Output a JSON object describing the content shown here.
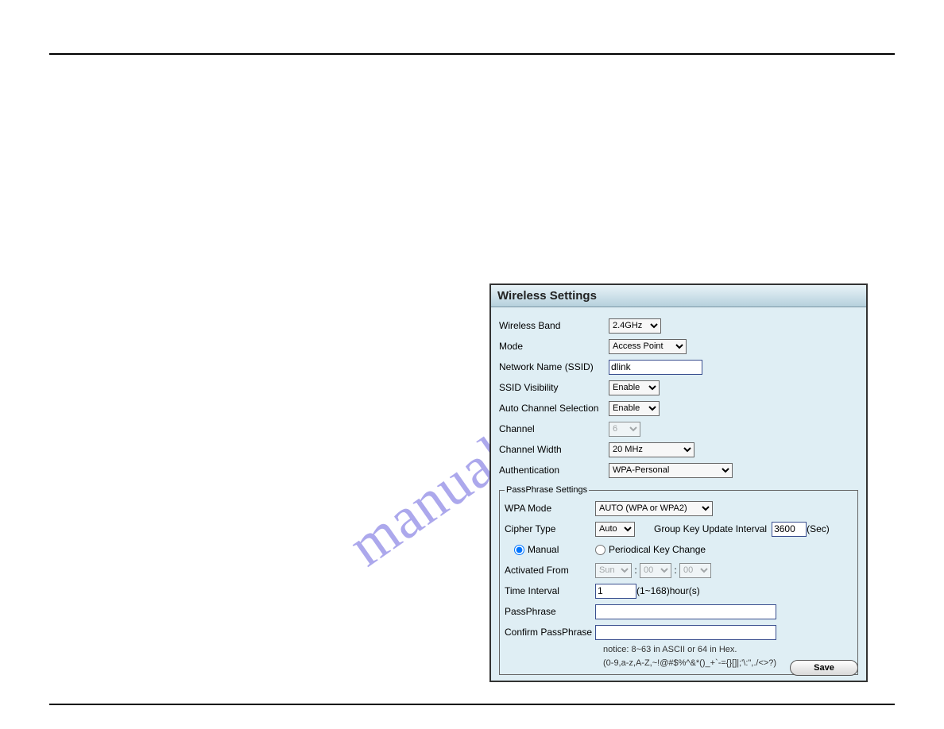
{
  "watermark": "manualshive.com",
  "panel": {
    "title": "Wireless Settings",
    "wireless_band": {
      "label": "Wireless Band",
      "value": "2.4GHz"
    },
    "mode": {
      "label": "Mode",
      "value": "Access Point"
    },
    "ssid": {
      "label": "Network Name (SSID)",
      "value": "dlink"
    },
    "ssid_visibility": {
      "label": "SSID Visibility",
      "value": "Enable"
    },
    "auto_channel": {
      "label": "Auto Channel Selection",
      "value": "Enable"
    },
    "channel": {
      "label": "Channel",
      "value": "6"
    },
    "channel_width": {
      "label": "Channel Width",
      "value": "20 MHz"
    },
    "authentication": {
      "label": "Authentication",
      "value": "WPA-Personal"
    },
    "passphrase": {
      "legend": "PassPhrase Settings",
      "wpa_mode": {
        "label": "WPA Mode",
        "value": "AUTO (WPA or WPA2)"
      },
      "cipher_type": {
        "label": "Cipher Type",
        "value": "Auto"
      },
      "group_key": {
        "label": "Group Key Update Interval",
        "value": "3600",
        "unit": "(Sec)"
      },
      "manual_label": "Manual",
      "periodical_label": "Periodical Key Change",
      "activated_from": {
        "label": "Activated From",
        "day": "Sun",
        "hh": "00",
        "mm": "00"
      },
      "time_interval": {
        "label": "Time Interval",
        "value": "1",
        "hint": "(1~168)hour(s)"
      },
      "pass": {
        "label": "PassPhrase",
        "value": ""
      },
      "confirm": {
        "label": "Confirm PassPhrase",
        "value": ""
      },
      "notice1": "notice: 8~63 in ASCII or 64 in Hex.",
      "notice2": "(0-9,a-z,A-Z,~!@#$%^&*()_+`-={}[]|;'\\:\",./<>?)"
    },
    "save": "Save"
  }
}
